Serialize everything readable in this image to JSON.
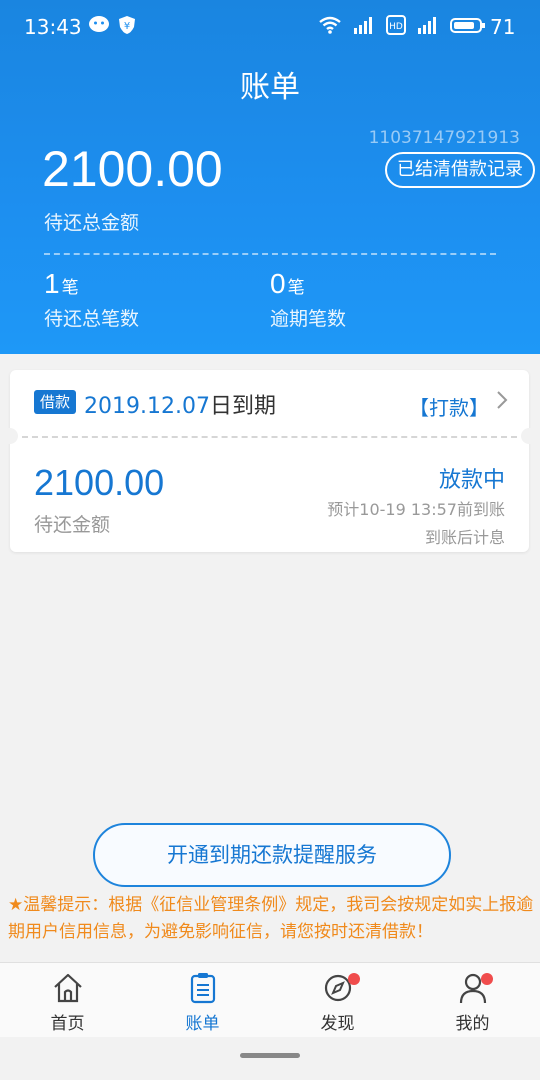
{
  "status": {
    "time": "13:43",
    "battery": "71"
  },
  "header": {
    "title": "账单",
    "account_no": "11037147921913",
    "records_button": "已结清借款记录",
    "total_amount": "2100.00",
    "total_label": "待还总金额",
    "stats": [
      {
        "num": "1",
        "unit": "笔",
        "label": "待还总笔数"
      },
      {
        "num": "0",
        "unit": "笔",
        "label": "逾期笔数"
      }
    ]
  },
  "card": {
    "tag": "借款",
    "due_date": "2019.12.07",
    "due_suffix": "日到期",
    "action": "【打款】",
    "amount": "2100.00",
    "amount_label": "待还金额",
    "state": "放款中",
    "eta": "预计10-19 13:57前到账",
    "interest": "到账后计息"
  },
  "remind_button": "开通到期还款提醒服务",
  "tip": "★温馨提示：根据《征信业管理条例》规定，我司会按规定如实上报逾期用户信用信息，为避免影响征信，请您按时还清借款！",
  "tabs": [
    {
      "label": "首页",
      "icon": "home-icon"
    },
    {
      "label": "账单",
      "icon": "bill-icon"
    },
    {
      "label": "发现",
      "icon": "compass-icon"
    },
    {
      "label": "我的",
      "icon": "user-icon"
    }
  ],
  "colors": {
    "primary": "#1677d2",
    "header": "#1d8ff0",
    "warning": "#f08a1c",
    "badge": "#f04c4c"
  }
}
